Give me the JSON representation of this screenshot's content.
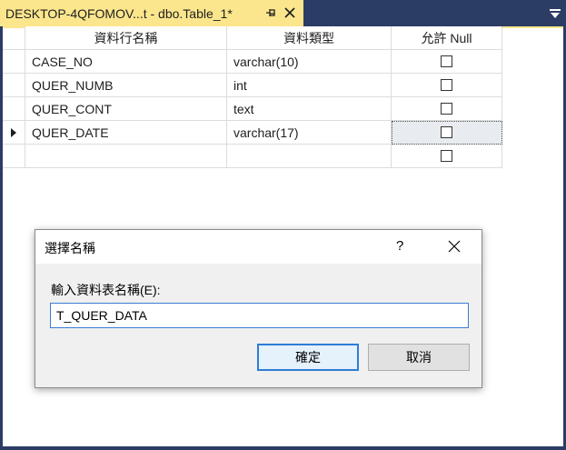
{
  "tab": {
    "title": "DESKTOP-4QFOMOV...t - dbo.Table_1*",
    "pin_icon": "pin-icon",
    "close_icon": "close-icon"
  },
  "grid": {
    "headers": [
      "資料行名稱",
      "資料類型",
      "允許 Null"
    ],
    "rows": [
      {
        "name": "CASE_NO",
        "type": "varchar(10)",
        "allow_null": false
      },
      {
        "name": "QUER_NUMB",
        "type": "int",
        "allow_null": false
      },
      {
        "name": "QUER_CONT",
        "type": "text",
        "allow_null": false
      },
      {
        "name": "QUER_DATE",
        "type": "varchar(17)",
        "allow_null": false,
        "current": true
      },
      {
        "name": "",
        "type": "",
        "allow_null": false
      }
    ]
  },
  "dialog": {
    "title": "選擇名稱",
    "help": "?",
    "label": "輸入資料表名稱(E):",
    "input_value": "T_QUER_DATA",
    "ok_label": "確定",
    "cancel_label": "取消"
  },
  "colors": {
    "frame": "#2b3c65",
    "tab_active": "#fce68d",
    "selection": "#e8ecf1",
    "primary_button_border": "#2e7dd5"
  }
}
